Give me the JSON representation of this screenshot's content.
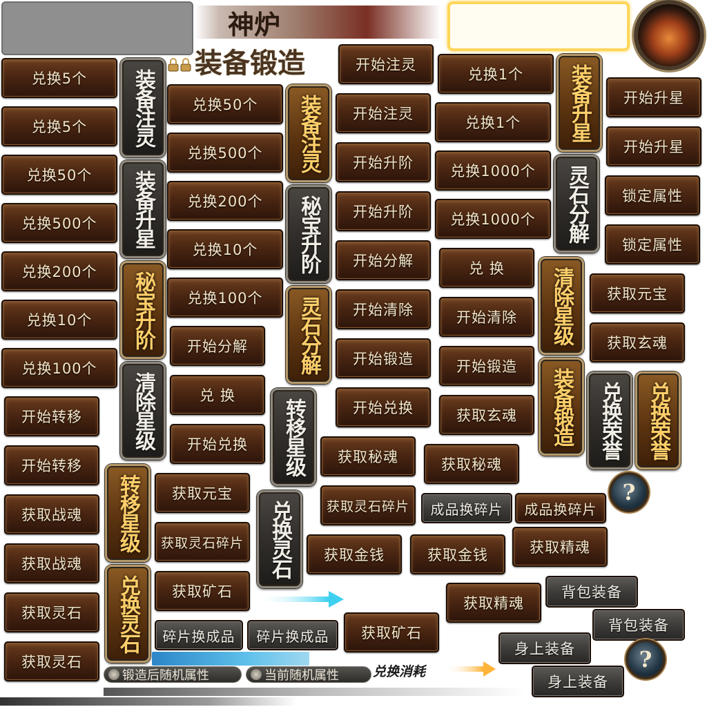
{
  "header": {
    "title": "神炉",
    "subtitle": "装备锻造",
    "icon": "furnace-icon",
    "lock_icon": "lock-icon"
  },
  "buttons": {
    "b_ex5_a": "兑换5个",
    "b_ex5_b": "兑换5个",
    "b_ex50_a": "兑换50个",
    "b_ex500_a": "兑换500个",
    "b_ex200_a": "兑换200个",
    "b_ex10_a": "兑换10个",
    "b_ex100_a": "兑换100个",
    "b_transfer_a": "开始转移",
    "b_transfer_b": "开始转移",
    "b_warsoul_a": "获取战魂",
    "b_warsoul_b": "获取战魂",
    "b_spirit_a": "获取灵石",
    "b_spirit_b": "获取灵石",
    "b_ex50_b": "兑换50个",
    "b_ex500_b": "兑换500个",
    "b_ex200_b": "兑换200个",
    "b_ex10_b": "兑换10个",
    "b_ex100_b": "兑换100个",
    "b_decomp_a": "开始分解",
    "b_exchange_a": "兑 换",
    "b_startex_a": "开始兑换",
    "b_yuanbao_a": "获取元宝",
    "b_shard_a": "获取灵石碎片",
    "b_ore_a": "获取矿石",
    "b_shard2item_a": "碎片换成品",
    "b_shard2item_b": "碎片换成品",
    "b_inject_a": "开始注灵",
    "b_inject_b": "开始注灵",
    "b_rank_a": "开始升阶",
    "b_rank_b": "开始升阶",
    "b_decomp_b": "开始分解",
    "b_clear_a": "开始清除",
    "b_forge_a": "开始锻造",
    "b_startex_b": "开始兑换",
    "b_secret_a": "获取秘魂",
    "b_shardget_b": "获取灵石碎片",
    "b_gold_a": "获取金钱",
    "b_ore_b": "获取矿石",
    "b_ex1_a": "兑换1个",
    "b_ex1_b": "兑换1个",
    "b_ex1000_a": "兑换1000个",
    "b_ex1000_b": "兑换1000个",
    "b_exchange_b": "兑 换",
    "b_clear_b": "开始清除",
    "b_forge_b": "开始锻造",
    "b_xuanhun_a": "获取玄魂",
    "b_secret_b": "获取秘魂",
    "b_item2shard_a": "成品换碎片",
    "b_item2shard_b": "成品换碎片",
    "b_gold_b": "获取金钱",
    "b_essence_a": "获取精魂",
    "b_essence_b": "获取精魂",
    "b_bag_a": "背包装备",
    "b_bag_b": "背包装备",
    "b_body_a": "身上装备",
    "b_body_b": "身上装备",
    "b_star_a": "开始升星",
    "b_star_b": "开始升星",
    "b_lock_a": "锁定属性",
    "b_lock_b": "锁定属性",
    "b_yuanbao_b": "获取元宝",
    "b_xuanhun_b": "获取玄魂"
  },
  "vertical_tabs": {
    "v_inject_dark": "装备注灵",
    "v_star_dark": "装备升星",
    "v_secret_gold": "秘宝升阶",
    "v_clear_dark": "清除星级",
    "v_transfer_gold": "转移星级",
    "v_exspirit_gold": "兑换灵石",
    "v_inject_gold": "装备注灵",
    "v_secret_dark": "秘宝升阶",
    "v_decomp_gold": "灵石分解",
    "v_transfer_dark": "转移星级",
    "v_exspirit_dark": "兑换灵石",
    "v_star_gold": "装备升星",
    "v_decomp_dark": "灵石分解",
    "v_clear_gold": "清除星级",
    "v_forge_gold": "装备锻造",
    "v_honor_dark": "兑换荣誉",
    "v_honor_gold": "兑换荣誉"
  },
  "labels": {
    "after_forge": "锻造后随机属性",
    "current_attr": "当前随机属性",
    "exchange_cost": "兑换消耗",
    "help_1": "?",
    "help_2": "?"
  },
  "colors": {
    "button_brown": "#4a2612",
    "button_text": "#f3e6c8",
    "tab_gold_text": "#ffcf6a",
    "highlight_yellow": "#ffd65a",
    "arrow_cyan": "#3fd0f0",
    "arrow_gold": "#ffb43a"
  }
}
